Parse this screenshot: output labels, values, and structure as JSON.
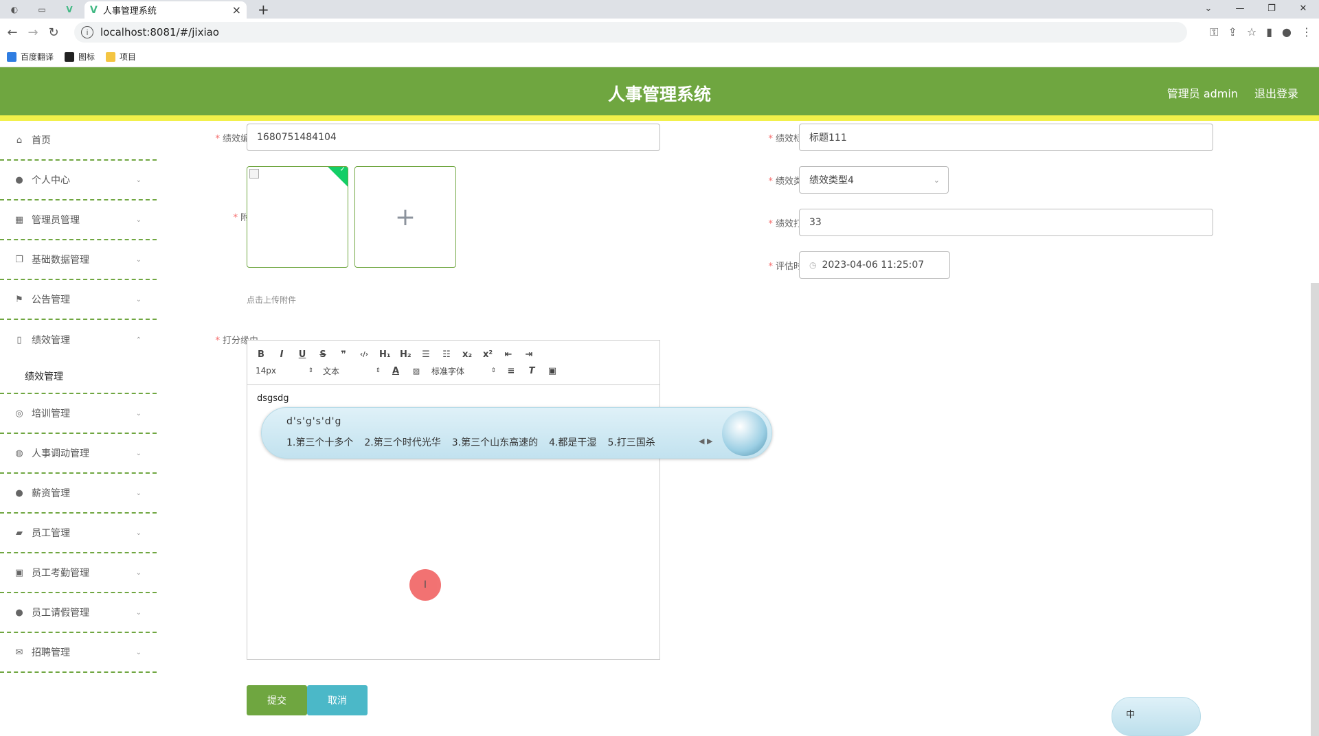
{
  "browser": {
    "tab_title": "人事管理系统",
    "url": "localhost:8081/#/jixiao",
    "new_tab": "+",
    "tab_close": "×",
    "window_controls": [
      "⌄",
      "—",
      "❐",
      "✕"
    ],
    "bookmarks": [
      {
        "label": "百度翻译",
        "color": "#2f7de1"
      },
      {
        "label": "图标",
        "color": "#222222"
      },
      {
        "label": "项目",
        "color": "#f4c542"
      }
    ]
  },
  "header": {
    "title": "人事管理系统",
    "user": "管理员 admin",
    "logout": "退出登录",
    "color": "#6fa640",
    "stripe_color": "#f2f04a"
  },
  "sidebar": {
    "items": [
      {
        "label": "首页",
        "icon": "home-icon",
        "glyph": "⌂",
        "chevron": ""
      },
      {
        "label": "个人中心",
        "icon": "user-icon",
        "glyph": "●",
        "chevron": "⌄"
      },
      {
        "label": "管理员管理",
        "icon": "chart-icon",
        "glyph": "▦",
        "chevron": "⌄"
      },
      {
        "label": "基础数据管理",
        "icon": "copy-icon",
        "glyph": "❐",
        "chevron": "⌄"
      },
      {
        "label": "公告管理",
        "icon": "flag-icon",
        "glyph": "⚑",
        "chevron": "⌄"
      },
      {
        "label": "绩效管理",
        "icon": "document-icon",
        "glyph": "▯",
        "chevron": "⌃"
      }
    ],
    "submenu": {
      "label": "绩效管理"
    },
    "items_after": [
      {
        "label": "培训管理",
        "icon": "compass-icon",
        "glyph": "◎",
        "chevron": "⌄"
      },
      {
        "label": "人事调动管理",
        "icon": "cycle-icon",
        "glyph": "◍",
        "chevron": "⌄"
      },
      {
        "label": "薪资管理",
        "icon": "location-icon",
        "glyph": "●",
        "chevron": "⌄"
      },
      {
        "label": "员工管理",
        "icon": "ticket-icon",
        "glyph": "▰",
        "chevron": "⌄"
      },
      {
        "label": "员工考勤管理",
        "icon": "clipboard-icon",
        "glyph": "▣",
        "chevron": "⌄"
      },
      {
        "label": "员工请假管理",
        "icon": "person-icon",
        "glyph": "●",
        "chevron": "⌄"
      },
      {
        "label": "招聘管理",
        "icon": "mail-icon",
        "glyph": "✉",
        "chevron": "⌄"
      }
    ]
  },
  "form": {
    "required_mark": "*",
    "perf_no_label": "绩效编号",
    "perf_no_value": "1680751484104",
    "attachment_label": "附件",
    "upload_hint": "点击上传附件",
    "upload_plus": "+",
    "upload_check": "✓",
    "reason_label": "打分缘由",
    "perf_title_label": "绩效标题",
    "perf_title_value": "标题111",
    "perf_type_label": "绩效类型",
    "perf_type_value": "绩效类型4",
    "perf_score_label": "绩效打分",
    "perf_score_value": "33",
    "eval_time_label": "评估时间",
    "eval_time_value": "2023-04-06 11:25:07"
  },
  "editor": {
    "toolbar_row1": [
      "B",
      "I",
      "U",
      "S",
      "❞",
      "‹/›",
      "H₁",
      "H₂",
      "☰",
      "☷",
      "x₂",
      "x²",
      "⇤",
      "⇥"
    ],
    "font_size": "14px",
    "block_type": "文本",
    "font_family": "标准字体",
    "content": "dsgsdg"
  },
  "ime": {
    "composition": "d's'g's'd'g",
    "candidates": [
      "1.第三个十多个",
      "2.第三个时代光华",
      "3.第三个山东高速的",
      "4.都是干湿",
      "5.打三国杀"
    ],
    "arrows": "◀ ▶",
    "mini_label": "中"
  },
  "buttons": {
    "submit": "提交",
    "cancel": "取消",
    "submit_color": "#6fa640",
    "cancel_color": "#4bb8c8"
  }
}
